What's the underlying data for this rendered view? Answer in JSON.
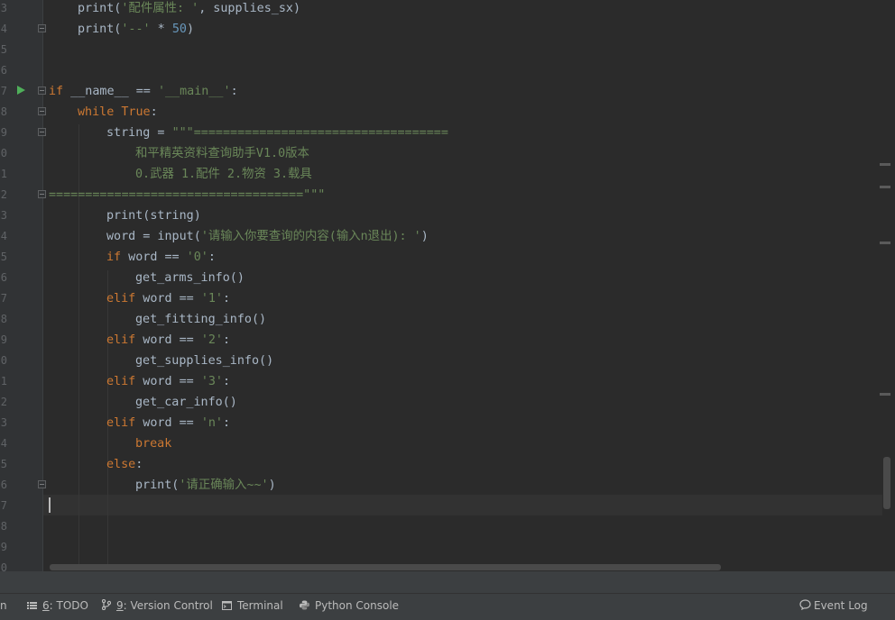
{
  "editor": {
    "line_numbers": [
      "3",
      "4",
      "5",
      "6",
      "7",
      "8",
      "9",
      "0",
      "1",
      "2",
      "3",
      "4",
      "5",
      "6",
      "7",
      "8",
      "9",
      "0",
      "1",
      "2",
      "3",
      "4",
      "5",
      "6",
      "7",
      "8",
      "9",
      "0"
    ],
    "lines": [
      {
        "id": "l3",
        "tokens": [
          [
            "fn",
            "print("
          ],
          [
            "str",
            "'配件属性: '"
          ],
          [
            "fn",
            ", supplies_sx)"
          ]
        ]
      },
      {
        "id": "l4",
        "tokens": [
          [
            "fn",
            "print("
          ],
          [
            "str",
            "'--'"
          ],
          [
            "fn",
            " * "
          ],
          [
            "num",
            "50"
          ],
          [
            "fn",
            ")"
          ]
        ]
      },
      {
        "id": "l7",
        "tokens": [
          [
            "kw",
            "if"
          ],
          [
            "fn",
            " __name__ == "
          ],
          [
            "str",
            "'__main__'"
          ],
          [
            "fn",
            ":"
          ]
        ]
      },
      {
        "id": "l8",
        "tokens": [
          [
            "kw",
            "while"
          ],
          [
            "fn",
            " "
          ],
          [
            "kw",
            "True"
          ],
          [
            "fn",
            ":"
          ]
        ]
      },
      {
        "id": "l9",
        "tokens": [
          [
            "fn",
            "string = "
          ],
          [
            "str",
            "\"\"\"==================================="
          ]
        ]
      },
      {
        "id": "l10",
        "tokens": [
          [
            "str",
            "和平精英资料查询助手V1.0版本"
          ]
        ]
      },
      {
        "id": "l11",
        "tokens": [
          [
            "str",
            "0.武器 1.配件 2.物资 3.载具"
          ]
        ]
      },
      {
        "id": "l12",
        "tokens": [
          [
            "str",
            "===================================\"\"\""
          ]
        ]
      },
      {
        "id": "l13",
        "tokens": [
          [
            "fn",
            "print(string)"
          ]
        ]
      },
      {
        "id": "l14",
        "tokens": [
          [
            "fn",
            "word = input("
          ],
          [
            "str",
            "'请输入你要查询的内容(输入n退出): '"
          ],
          [
            "fn",
            ")"
          ]
        ]
      },
      {
        "id": "l15",
        "tokens": [
          [
            "kw",
            "if"
          ],
          [
            "fn",
            " word == "
          ],
          [
            "str",
            "'0'"
          ],
          [
            "fn",
            ":"
          ]
        ]
      },
      {
        "id": "l16",
        "tokens": [
          [
            "fn",
            "get_arms_info()"
          ]
        ]
      },
      {
        "id": "l17",
        "tokens": [
          [
            "kw",
            "elif"
          ],
          [
            "fn",
            " word == "
          ],
          [
            "str",
            "'1'"
          ],
          [
            "fn",
            ":"
          ]
        ]
      },
      {
        "id": "l18",
        "tokens": [
          [
            "fn",
            "get_fitting_info()"
          ]
        ]
      },
      {
        "id": "l19",
        "tokens": [
          [
            "kw",
            "elif"
          ],
          [
            "fn",
            " word == "
          ],
          [
            "str",
            "'2'"
          ],
          [
            "fn",
            ":"
          ]
        ]
      },
      {
        "id": "l20",
        "tokens": [
          [
            "fn",
            "get_supplies_info()"
          ]
        ]
      },
      {
        "id": "l21",
        "tokens": [
          [
            "kw",
            "elif"
          ],
          [
            "fn",
            " word == "
          ],
          [
            "str",
            "'3'"
          ],
          [
            "fn",
            ":"
          ]
        ]
      },
      {
        "id": "l22",
        "tokens": [
          [
            "fn",
            "get_car_info()"
          ]
        ]
      },
      {
        "id": "l23",
        "tokens": [
          [
            "kw",
            "elif"
          ],
          [
            "fn",
            " word == "
          ],
          [
            "str",
            "'n'"
          ],
          [
            "fn",
            ":"
          ]
        ]
      },
      {
        "id": "l24",
        "tokens": [
          [
            "kw",
            "break"
          ]
        ]
      },
      {
        "id": "l25",
        "tokens": [
          [
            "kw",
            "else"
          ],
          [
            "fn",
            ":"
          ]
        ]
      },
      {
        "id": "l26",
        "tokens": [
          [
            "fn",
            "print("
          ],
          [
            "str",
            "'请正确输入~~'"
          ],
          [
            "fn",
            ")"
          ]
        ]
      }
    ]
  },
  "toolbar": {
    "run_partial": "n",
    "todo_num": "6",
    "todo_label": ": TODO",
    "vcs_num": "9",
    "vcs_label": ": Version Control",
    "terminal_label": "Terminal",
    "python_console_label": "Python Console",
    "event_log_label": "Event Log"
  },
  "colors": {
    "background": "#2b2b2b",
    "keyword": "#cc7832",
    "string": "#6a8759",
    "number": "#6897bb",
    "text": "#a9b7c6",
    "run_green": "#4faf5a"
  },
  "icons": [
    "run-arrow-icon",
    "fold-icon",
    "todo-list-icon",
    "version-control-icon",
    "terminal-icon",
    "python-console-icon",
    "event-log-icon"
  ]
}
